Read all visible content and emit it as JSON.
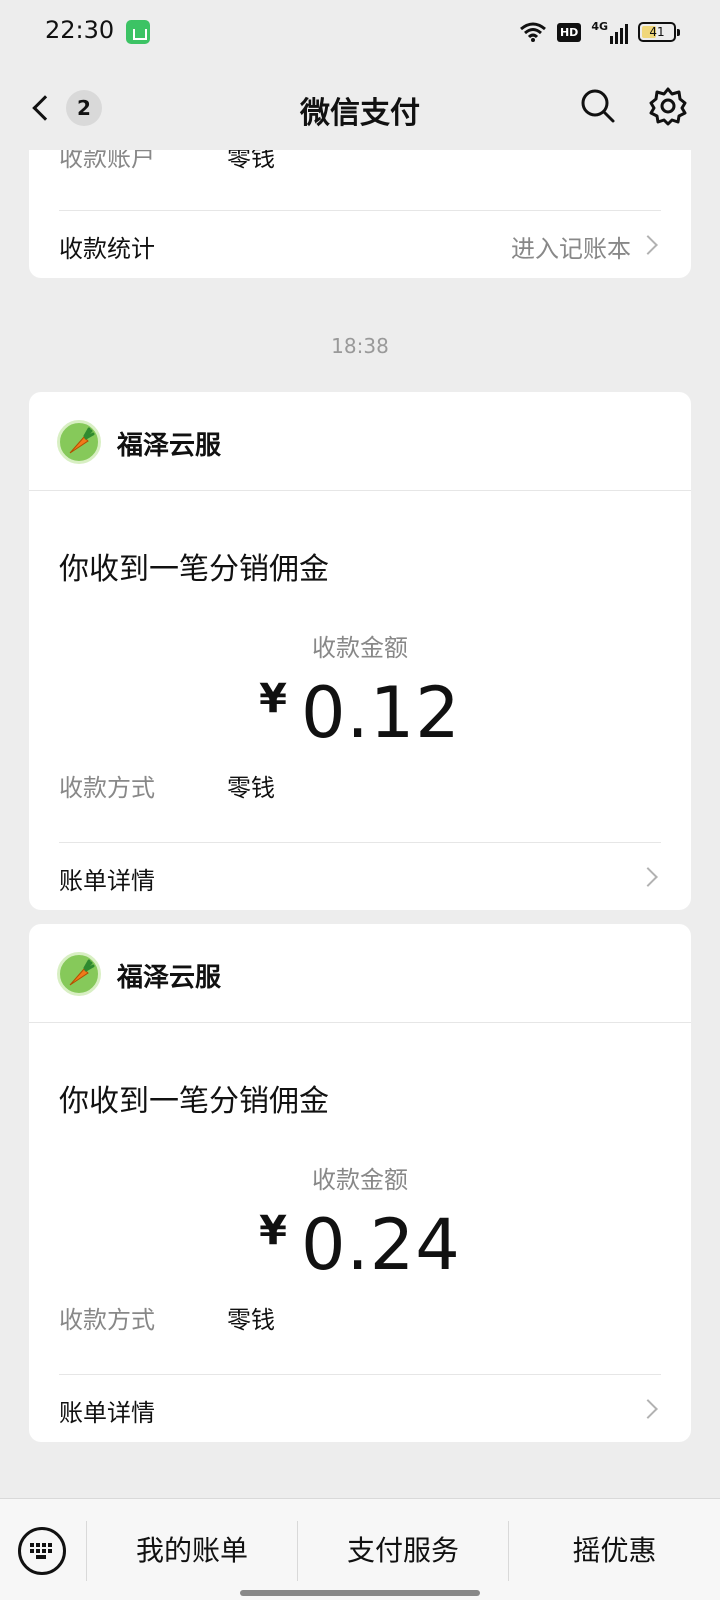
{
  "status_bar": {
    "time": "22:30",
    "hd": "HD",
    "network": "4G",
    "battery": "41"
  },
  "nav": {
    "unread_count": "2",
    "title": "微信支付"
  },
  "top_card": {
    "account_label": "收款账户",
    "account_value": "零钱",
    "stats_label": "收款统计",
    "stats_link": "进入记账本"
  },
  "timestamp": "18:38",
  "messages": [
    {
      "merchant": "福泽云服",
      "title": "你收到一笔分销佣金",
      "amount_label": "收款金额",
      "currency": "¥",
      "amount": "0.12",
      "method_label": "收款方式",
      "method_value": "零钱",
      "details_label": "账单详情"
    },
    {
      "merchant": "福泽云服",
      "title": "你收到一笔分销佣金",
      "amount_label": "收款金额",
      "currency": "¥",
      "amount": "0.24",
      "method_label": "收款方式",
      "method_value": "零钱",
      "details_label": "账单详情"
    }
  ],
  "bottom_bar": {
    "items": [
      "我的账单",
      "支付服务",
      "摇优惠"
    ]
  }
}
